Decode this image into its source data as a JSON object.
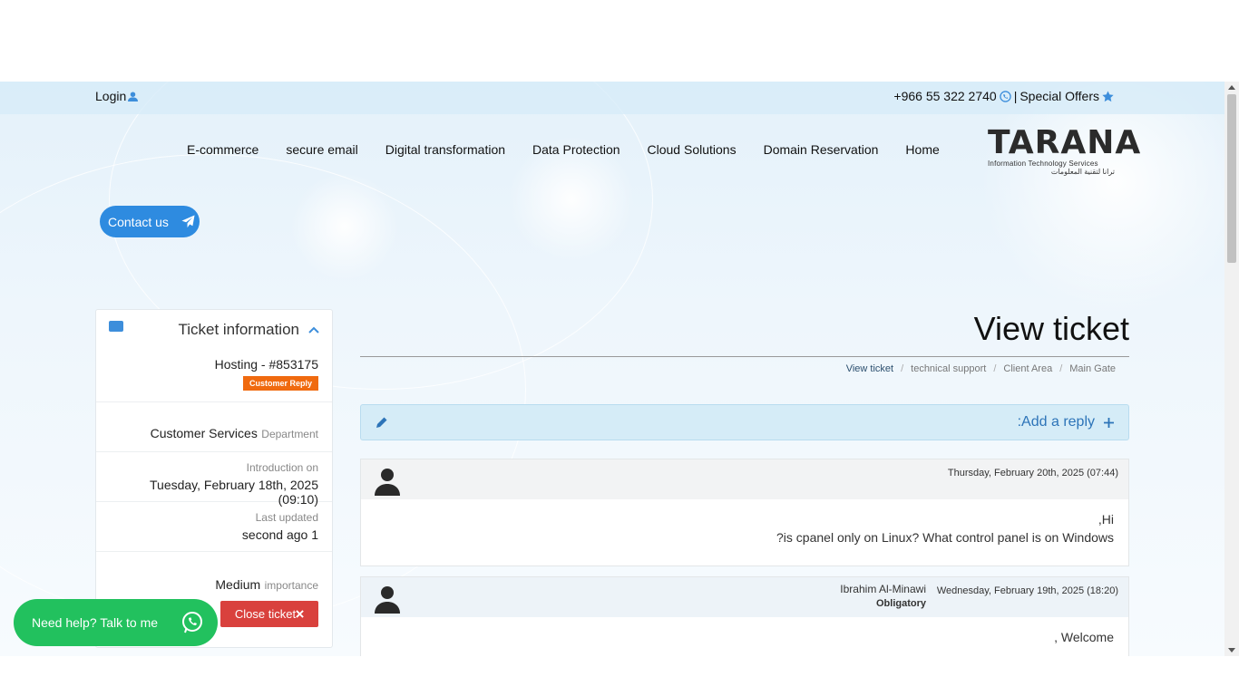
{
  "topbar": {
    "login": "Login",
    "phone": "+966 55 322 2740",
    "separator": "|",
    "special_offers": "Special Offers"
  },
  "nav": [
    "E-commerce",
    "secure email",
    "Digital transformation",
    "Data Protection",
    "Cloud Solutions",
    "Domain Reservation",
    "Home"
  ],
  "logo": {
    "name": "TARANA",
    "subtitle": "Information Technology Services",
    "arabic": "ترانا لتقنية المعلومات"
  },
  "contact_button": "Contact us",
  "sidebar": {
    "title": "Ticket information",
    "ticket_ref": "Hosting - #853175",
    "status_badge": "Customer Reply",
    "department_value": "Customer Services",
    "department_label": "Department",
    "intro_label": "Introduction on",
    "intro_value": "Tuesday, February 18th, 2025 (09:10)",
    "updated_label": "Last updated",
    "updated_value": "second ago 1",
    "priority_value": "Medium",
    "priority_label": "importance",
    "close_button": "Close ticket"
  },
  "page": {
    "title": "View ticket",
    "breadcrumb": [
      "View ticket",
      "technical support",
      "Client Area",
      "Main Gate"
    ],
    "reply_bar": ":Add a reply"
  },
  "messages": [
    {
      "date": "Thursday, February 20th, 2025 (07:44)",
      "lines": [
        ",Hi",
        "?is cpanel only on Linux? What control panel is on Windows"
      ]
    },
    {
      "author": "Ibrahim Al-Minawi",
      "role": "Obligatory",
      "date": "Wednesday, February 19th, 2025 (18:20)",
      "lines": [
        ", Welcome"
      ]
    }
  ],
  "whatsapp": {
    "label": "Need help? Talk to me"
  },
  "colors": {
    "accent": "#2e8be0",
    "badge": "#f06a0f",
    "danger": "#d9413d",
    "whatsapp": "#22c15e",
    "reply_bar": "#d5ecf7"
  }
}
